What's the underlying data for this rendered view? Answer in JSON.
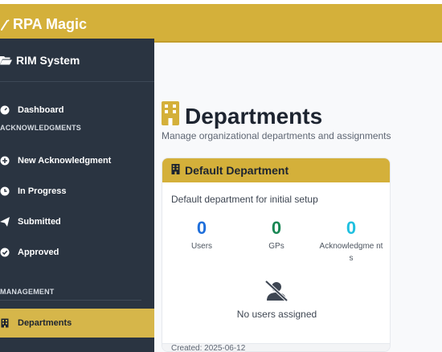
{
  "app": {
    "brand": "RPA Magic",
    "system": "RIM System"
  },
  "sidebar": {
    "dashboard": "Dashboard",
    "section_ack": "ACKNOWLEDGMENTS",
    "new_ack": "New Acknowledgment",
    "in_progress": "In Progress",
    "submitted": "Submitted",
    "approved": "Approved",
    "section_mgmt": "MANAGEMENT",
    "departments": "Departments"
  },
  "page": {
    "title": "Departments",
    "subtitle": "Manage organizational departments and assignments"
  },
  "card": {
    "title": "Default Department",
    "description": "Default department for initial setup",
    "stats": {
      "users": {
        "value": "0",
        "label": "Users"
      },
      "gps": {
        "value": "0",
        "label": "GPs"
      },
      "ack": {
        "value": "0",
        "label": "Acknowledgme nts"
      }
    },
    "empty_text": "No users assigned",
    "footer": "Created: 2025-06-12"
  },
  "colors": {
    "accent": "#d4b03a",
    "sidebar_bg": "#2a3441",
    "stat_users": "#1f6fdb",
    "stat_gps": "#198754",
    "stat_ack": "#20c0e0"
  },
  "icons": {
    "brand": "magic-wand-icon",
    "system": "folder-open-icon",
    "dashboard": "gauge-icon",
    "new_ack": "plus-circle-icon",
    "in_progress": "clock-icon",
    "submitted": "paper-plane-icon",
    "approved": "check-circle-icon",
    "departments": "building-icon",
    "page": "building-icon",
    "empty": "user-slash-icon"
  }
}
